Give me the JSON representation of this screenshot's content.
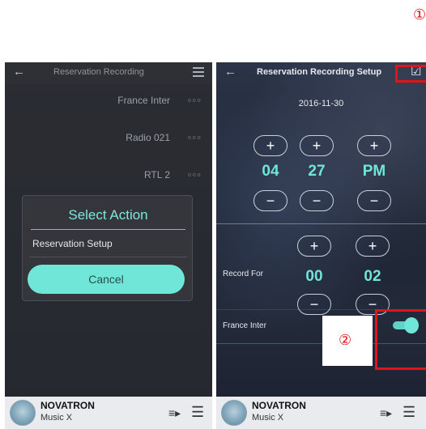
{
  "left_screen": {
    "header": {
      "back_glyph": "←",
      "title": "Reservation Recording"
    },
    "stations": [
      {
        "name": "France Inter",
        "more": "ooo"
      },
      {
        "name": "Radio 021",
        "more": "ooo"
      },
      {
        "name": "RTL 2",
        "more": "ooo"
      }
    ],
    "dialog": {
      "title": "Select Action",
      "option": "Reservation Setup",
      "cancel_label": "Cancel"
    }
  },
  "right_screen": {
    "header": {
      "back_glyph": "←",
      "title": "Reservation Recording Setup",
      "confirm_glyph": "☑"
    },
    "date": "2016-11-30",
    "time": {
      "hour": "04",
      "minute": "27",
      "ampm": "PM"
    },
    "record_for": {
      "label": "Record For",
      "hours": "00",
      "minutes": "02"
    },
    "station_label": "France Inter",
    "toggle_on": true,
    "plus": "+",
    "minus": "−"
  },
  "player": {
    "brand": "NOVATRON",
    "sub": "Music X",
    "queue_glyph": "≡▸",
    "list_glyph": "☰"
  },
  "annotations": {
    "marker1": "①",
    "marker2": "②",
    "color": "#e2141a"
  },
  "colors": {
    "accent": "#6fe6d8"
  }
}
